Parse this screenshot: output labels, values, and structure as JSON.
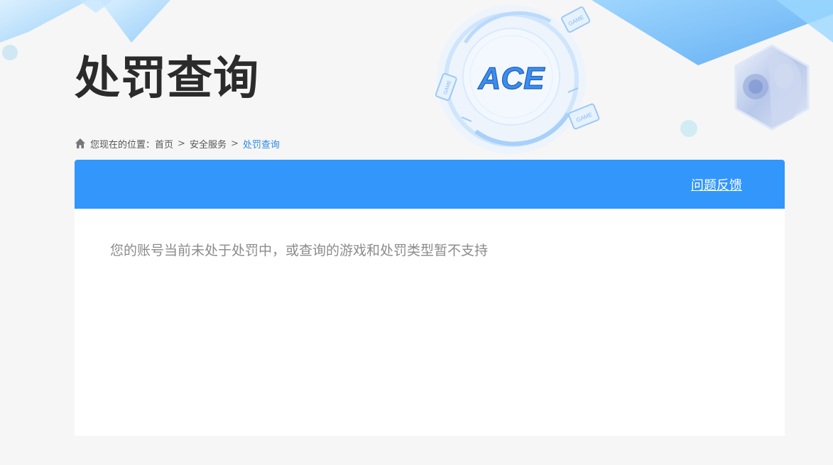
{
  "page": {
    "title": "处罚查询"
  },
  "brand": {
    "logo_text": "ACE",
    "badge_text": "GAME"
  },
  "breadcrumb": {
    "prefix": "您现在的位置：",
    "items": [
      "首页",
      "安全服务",
      "处罚查询"
    ],
    "separator": ">"
  },
  "panel": {
    "feedback_label": "问题反馈",
    "message": "您的账号当前未处于处罚中，或查询的游戏和处罚类型暂不支持"
  },
  "colors": {
    "header_bg": "#3396fb",
    "link_active": "#2d8ae0"
  }
}
